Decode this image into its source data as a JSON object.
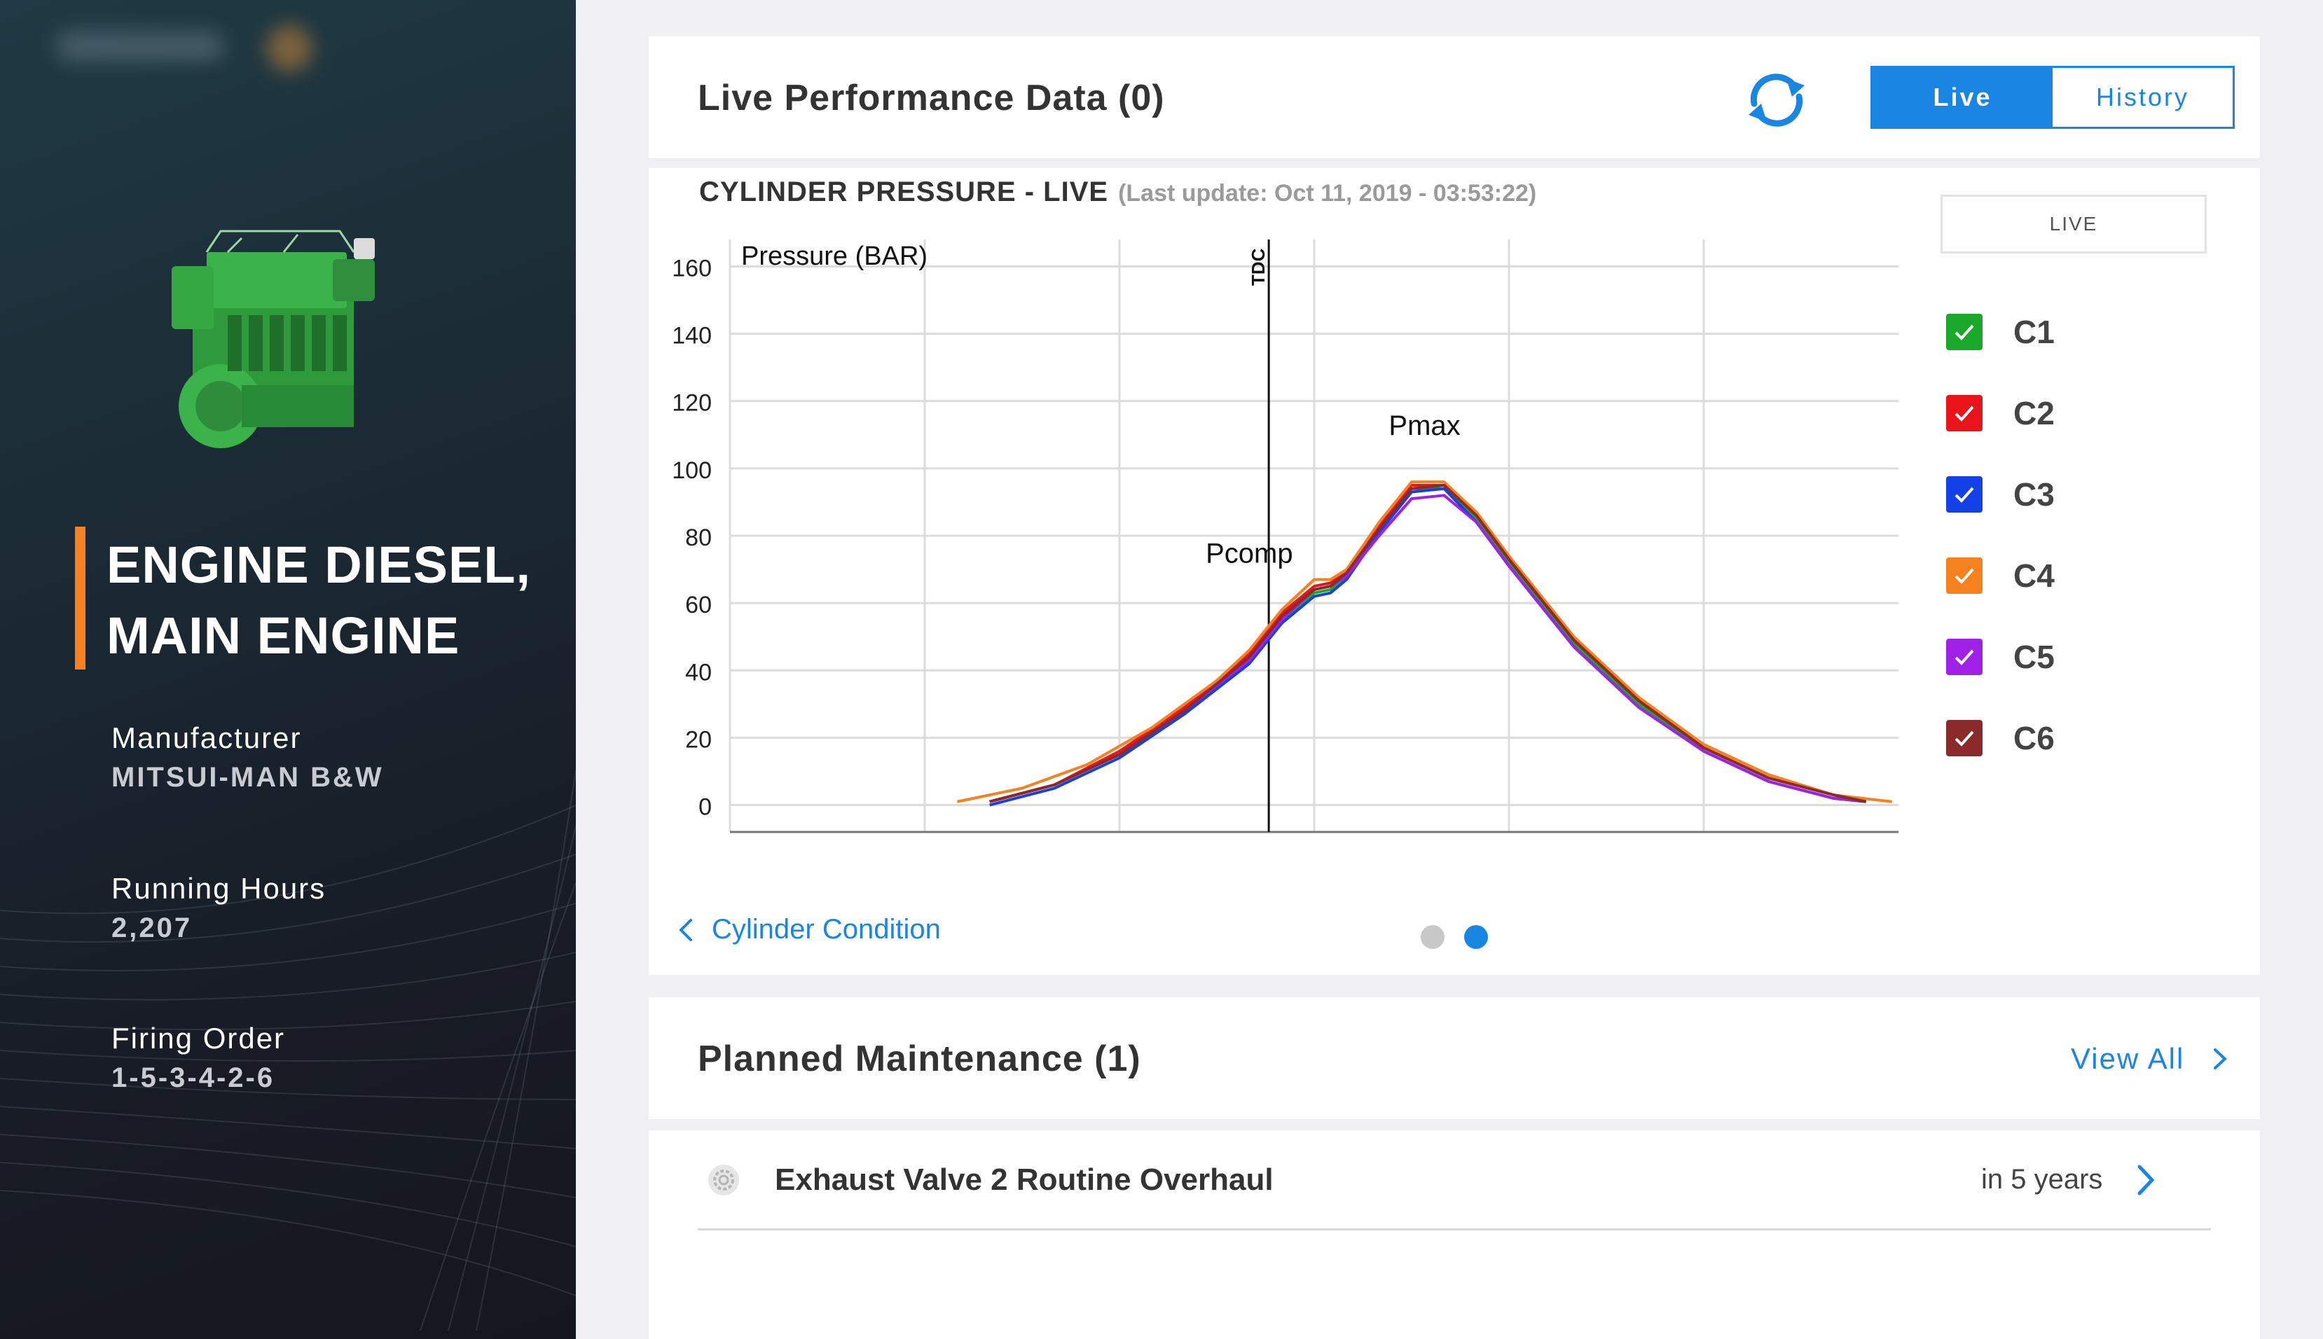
{
  "sidebar": {
    "title_line1": "ENGINE DIESEL,",
    "title_line2": "MAIN ENGINE",
    "manufacturer_label": "Manufacturer",
    "manufacturer_value": "MITSUI-MAN B&W",
    "hours_label": "Running Hours",
    "hours_value": "2,207",
    "firing_label": "Firing Order",
    "firing_value": "1-5-3-4-2-6",
    "accent_color": "#f5821f"
  },
  "performance": {
    "title": "Live Performance Data (0)",
    "refresh_icon": "refresh-icon",
    "toggle": {
      "live": "Live",
      "history": "History",
      "active": "live"
    },
    "accent_color": "#1a86e3"
  },
  "chart_data": {
    "type": "line",
    "title": "CYLINDER PRESSURE - LIVE",
    "subtitle": "(Last update: Oct 11, 2019 - 03:53:22)",
    "ylabel": "Pressure (BAR)",
    "xlabel": "",
    "ylim": [
      -8,
      168
    ],
    "yticks": [
      0,
      20,
      40,
      60,
      80,
      100,
      120,
      140,
      160
    ],
    "xlim": [
      -180,
      180
    ],
    "grid": true,
    "tdc_label": "TDC",
    "annotations": [
      {
        "text": "Pcomp",
        "x": -20,
        "y": 72
      },
      {
        "text": "Pmax",
        "x": 34,
        "y": 110
      }
    ],
    "legend_title": "LIVE",
    "legend_placement": "right",
    "series": [
      {
        "name": "C1",
        "color": "#1aa82a",
        "values": [
          [
            -100,
            1
          ],
          [
            -80,
            6
          ],
          [
            -60,
            15
          ],
          [
            -40,
            28
          ],
          [
            -20,
            43
          ],
          [
            -10,
            55
          ],
          [
            0,
            63
          ],
          [
            5,
            64
          ],
          [
            10,
            68
          ],
          [
            20,
            82
          ],
          [
            30,
            94
          ],
          [
            40,
            94
          ],
          [
            50,
            85
          ],
          [
            60,
            72
          ],
          [
            80,
            48
          ],
          [
            100,
            30
          ],
          [
            120,
            17
          ],
          [
            140,
            8
          ],
          [
            160,
            3
          ],
          [
            170,
            1
          ]
        ]
      },
      {
        "name": "C2",
        "color": "#e8141a",
        "values": [
          [
            -100,
            1
          ],
          [
            -80,
            6
          ],
          [
            -60,
            16
          ],
          [
            -40,
            29
          ],
          [
            -20,
            45
          ],
          [
            -10,
            57
          ],
          [
            0,
            65
          ],
          [
            5,
            66
          ],
          [
            10,
            69
          ],
          [
            20,
            83
          ],
          [
            30,
            95
          ],
          [
            40,
            95
          ],
          [
            50,
            86
          ],
          [
            60,
            73
          ],
          [
            80,
            49
          ],
          [
            100,
            31
          ],
          [
            120,
            18
          ],
          [
            140,
            9
          ],
          [
            160,
            3
          ],
          [
            170,
            1
          ]
        ]
      },
      {
        "name": "C3",
        "color": "#1440e8",
        "values": [
          [
            -100,
            0
          ],
          [
            -80,
            5
          ],
          [
            -60,
            14
          ],
          [
            -40,
            27
          ],
          [
            -20,
            42
          ],
          [
            -10,
            54
          ],
          [
            0,
            62
          ],
          [
            5,
            63
          ],
          [
            10,
            67
          ],
          [
            20,
            81
          ],
          [
            30,
            93
          ],
          [
            40,
            94
          ],
          [
            50,
            84
          ],
          [
            60,
            71
          ],
          [
            80,
            47
          ],
          [
            100,
            29
          ],
          [
            120,
            16
          ],
          [
            140,
            7
          ],
          [
            160,
            2
          ],
          [
            170,
            1
          ]
        ]
      },
      {
        "name": "C4",
        "color": "#f5821f",
        "values": [
          [
            -110,
            1
          ],
          [
            -90,
            5
          ],
          [
            -70,
            12
          ],
          [
            -50,
            23
          ],
          [
            -30,
            37
          ],
          [
            -20,
            46
          ],
          [
            -10,
            58
          ],
          [
            0,
            67
          ],
          [
            5,
            67
          ],
          [
            10,
            70
          ],
          [
            20,
            84
          ],
          [
            30,
            96
          ],
          [
            40,
            96
          ],
          [
            50,
            87
          ],
          [
            60,
            74
          ],
          [
            80,
            50
          ],
          [
            100,
            32
          ],
          [
            120,
            18
          ],
          [
            140,
            9
          ],
          [
            160,
            3
          ],
          [
            178,
            1
          ]
        ]
      },
      {
        "name": "C5",
        "color": "#a020e8",
        "values": [
          [
            -100,
            1
          ],
          [
            -80,
            6
          ],
          [
            -60,
            15
          ],
          [
            -40,
            28
          ],
          [
            -20,
            43
          ],
          [
            -10,
            55
          ],
          [
            0,
            64
          ],
          [
            5,
            65
          ],
          [
            10,
            68
          ],
          [
            20,
            80
          ],
          [
            30,
            91
          ],
          [
            40,
            92
          ],
          [
            50,
            84
          ],
          [
            60,
            71
          ],
          [
            80,
            47
          ],
          [
            100,
            29
          ],
          [
            120,
            16
          ],
          [
            140,
            7
          ],
          [
            160,
            2
          ],
          [
            170,
            1
          ]
        ]
      },
      {
        "name": "C6",
        "color": "#8a2a2a",
        "values": [
          [
            -100,
            1
          ],
          [
            -80,
            6
          ],
          [
            -60,
            15
          ],
          [
            -40,
            28
          ],
          [
            -20,
            44
          ],
          [
            -10,
            56
          ],
          [
            0,
            64
          ],
          [
            5,
            65
          ],
          [
            10,
            69
          ],
          [
            20,
            82
          ],
          [
            30,
            94
          ],
          [
            40,
            95
          ],
          [
            50,
            86
          ],
          [
            60,
            73
          ],
          [
            80,
            49
          ],
          [
            100,
            31
          ],
          [
            120,
            17
          ],
          [
            140,
            8
          ],
          [
            160,
            3
          ],
          [
            170,
            1
          ]
        ]
      }
    ]
  },
  "carousel": {
    "link_label": "Cylinder Condition",
    "pages": 2,
    "active_page": 2
  },
  "maintenance": {
    "title": "Planned Maintenance (1)",
    "view_all": "View All",
    "items": [
      {
        "task": "Exhaust Valve 2 Routine Overhaul",
        "due": "in 5 years",
        "icon": "gear-icon"
      }
    ]
  }
}
